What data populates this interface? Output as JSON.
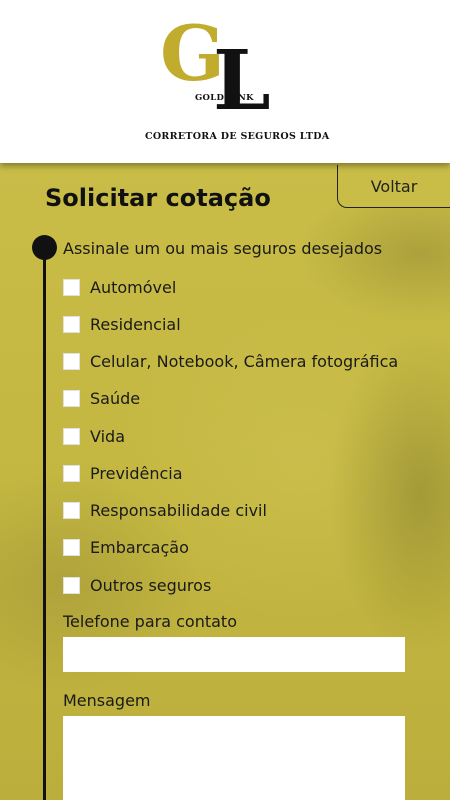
{
  "header": {
    "logo_letter_g": "G",
    "logo_letter_l": "L",
    "logo_name": "GOLD LINK",
    "company_name": "CORRETORA DE SEGUROS LTDA"
  },
  "page": {
    "title": "Solicitar cotação",
    "back_label": "Voltar"
  },
  "form": {
    "insurance_prompt": "Assinale um ou mais seguros desejados",
    "options": [
      {
        "label": "Automóvel",
        "checked": false
      },
      {
        "label": "Residencial",
        "checked": false
      },
      {
        "label": "Celular, Notebook, Câmera fotográfica",
        "checked": false
      },
      {
        "label": "Saúde",
        "checked": false
      },
      {
        "label": "Vida",
        "checked": false
      },
      {
        "label": "Previdência",
        "checked": false
      },
      {
        "label": "Responsabilidade civil",
        "checked": false
      },
      {
        "label": "Embarcação",
        "checked": false
      },
      {
        "label": "Outros seguros",
        "checked": false
      }
    ],
    "phone_label": "Telefone para contato",
    "phone_value": "",
    "message_label": "Mensagem",
    "message_value": ""
  },
  "colors": {
    "brand_gold": "#c2ac2e",
    "background_olive": "#c5b942",
    "text_dark": "#111111"
  }
}
